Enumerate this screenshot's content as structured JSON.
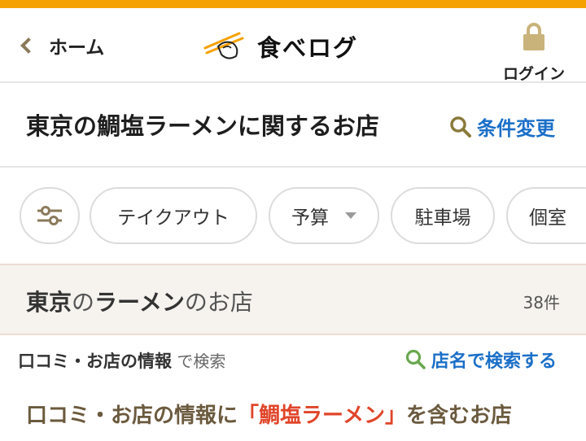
{
  "colors": {
    "accent_stripe": "#f5a100",
    "link_blue": "#1b6fc8",
    "keyword_red": "#e0452a",
    "band_bg": "#f6f3ef",
    "search_icon_green": "#6aa84f",
    "cond_icon_olive": "#8a7a3a"
  },
  "header": {
    "back_label": "ホーム",
    "logo_text": "食べログ",
    "login_label": "ログイン",
    "icons": {
      "back": "chevron-left-icon",
      "logo": "chopsticks-logo-icon",
      "login": "lock-icon"
    }
  },
  "title": {
    "text": "東京の鯛塩ラーメンに関するお店",
    "change_label": "条件変更"
  },
  "filters": {
    "chips": [
      "テイクアウト",
      "予算",
      "駐車場",
      "個室"
    ],
    "icon": "sliders-icon"
  },
  "results": {
    "area": "東京",
    "particle1": "の",
    "genre": "ラーメン",
    "suffix": "のお店",
    "count": "38件"
  },
  "search": {
    "label_bold": "口コミ・お店の情報",
    "label_light": " で検索",
    "shop_name_label": "店名で検索する"
  },
  "contains": {
    "prefix": "口コミ・お店の情報に",
    "keyword": "「鯛塩ラーメン」",
    "suffix": "を含むお店"
  }
}
